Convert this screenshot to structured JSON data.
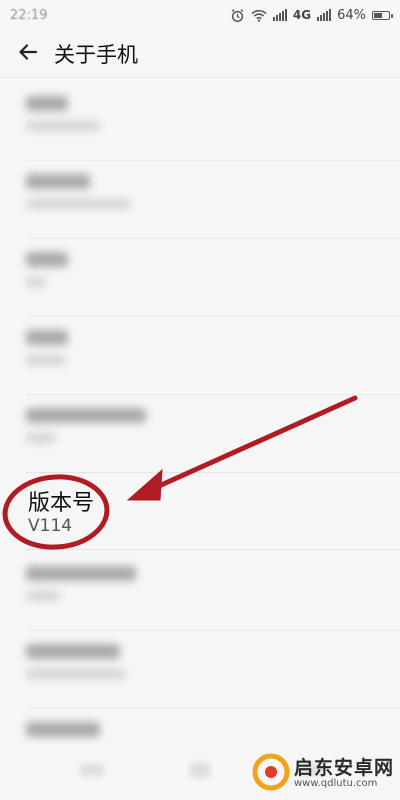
{
  "status_bar": {
    "time": "22:19",
    "network": "4G",
    "battery": "64%",
    "battery_level": 0.64
  },
  "header": {
    "title": "关于手机",
    "back_icon": "arrow-left-icon"
  },
  "version_item": {
    "label": "版本号",
    "value": "V114"
  },
  "annotation": {
    "circle_color": "#b01c22",
    "arrow_color": "#b01c22"
  },
  "watermark": {
    "name": "启东安卓网",
    "url": "www.qdlutu.com",
    "brand_color": "#f2a21b"
  }
}
